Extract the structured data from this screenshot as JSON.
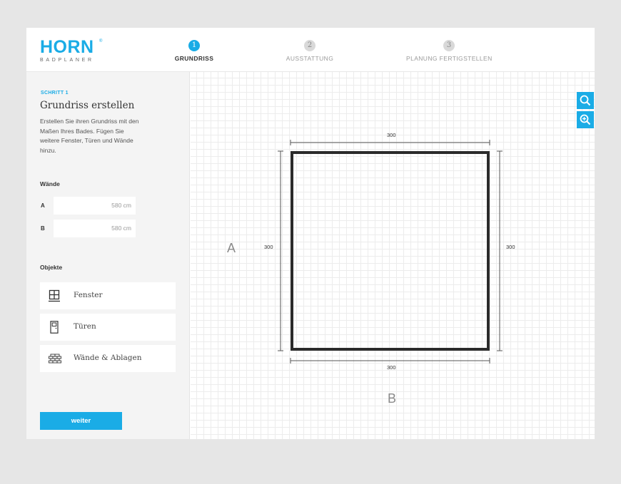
{
  "header": {
    "logo": "HORN",
    "logo_mark": "®",
    "logo_sub": "BADPLANER",
    "steps": [
      {
        "num": "1",
        "label": "GRUNDRISS"
      },
      {
        "num": "2",
        "label": "AUSSTATTUNG"
      },
      {
        "num": "3",
        "label": "PLANUNG FERTIGSTELLEN"
      }
    ]
  },
  "sidebar": {
    "step_tag": "SCHRITT 1",
    "title": "Grundriss erstellen",
    "description": "Erstellen Sie ihren Grundriss mit den Maßen Ihres Bades. Fügen Sie weitere Fenster, Türen und Wände hinzu.",
    "walls_label": "Wände",
    "walls": [
      {
        "key": "A",
        "value": "580 cm"
      },
      {
        "key": "B",
        "value": "580 cm"
      }
    ],
    "objects_label": "Objekte",
    "objects": [
      {
        "label": "Fenster",
        "icon": "window-icon"
      },
      {
        "label": "Türen",
        "icon": "door-icon"
      },
      {
        "label": "Wände & Ablagen",
        "icon": "brick-wall-icon"
      }
    ],
    "next_label": "weiter"
  },
  "canvas": {
    "dim_top": "300",
    "dim_bottom": "300",
    "dim_left": "300",
    "dim_right": "300",
    "wall_a": "A",
    "wall_b": "B",
    "zoom_out_icon": "search-icon",
    "zoom_in_icon": "zoom-in-icon"
  },
  "colors": {
    "accent": "#1aace6",
    "background": "#e6e6e6",
    "sidebar": "#f4f4f4",
    "wall": "#2b2b2b"
  }
}
